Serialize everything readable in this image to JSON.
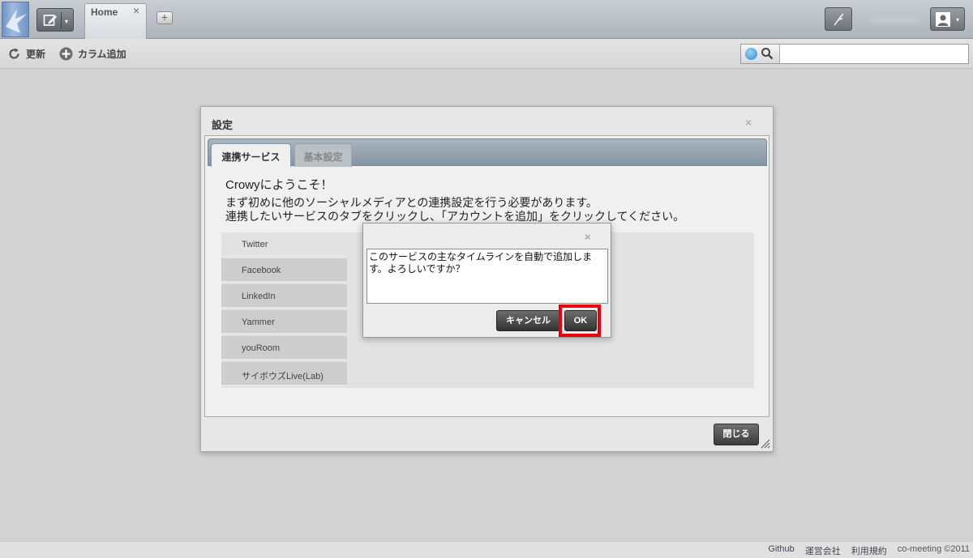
{
  "topbar": {
    "tabs": [
      {
        "label": "Home",
        "close": "×"
      }
    ],
    "add_tab": "+",
    "compose_caret": "▾",
    "account_caret": "▾"
  },
  "toolbar": {
    "refresh_label": "更新",
    "add_column_label": "カラム追加",
    "search_placeholder": ""
  },
  "settings_dialog": {
    "title": "設定",
    "close": "×",
    "tabs": [
      {
        "label": "連携サービス",
        "active": true
      },
      {
        "label": "基本設定",
        "active": false
      }
    ],
    "welcome_lines": [
      "Crowyにようこそ！",
      "まず初めに他のソーシャルメディアとの連携設定を行う必要があります。",
      "連携したいサービスのタブをクリックし、「アカウントを追加」をクリックしてください。"
    ],
    "services": [
      "Twitter",
      "Facebook",
      "LinkedIn",
      "Yammer",
      "youRoom",
      "サイボウズLive(Lab)"
    ],
    "selected_service": "Twitter",
    "close_button": "閉じる"
  },
  "confirm_dialog": {
    "close": "×",
    "message": "このサービスの主なタイムラインを自動で追加します。よろしいですか？",
    "cancel_button": "キャンセル",
    "ok_button": "OK",
    "highlight_color": "#e8000d"
  },
  "footer": {
    "links": [
      "Github",
      "運営会社",
      "利用規約"
    ],
    "copyright": "co-meeting ©2011"
  },
  "icons": {
    "logo": "bird-logo-icon",
    "compose": "compose-icon",
    "post": "feather-pen-icon",
    "account": "user-icon",
    "refresh": "refresh-icon",
    "add_column": "plus-circle-icon",
    "search_scope": "globe-icon",
    "search": "magnifier-icon",
    "resize": "resize-grip-icon"
  }
}
